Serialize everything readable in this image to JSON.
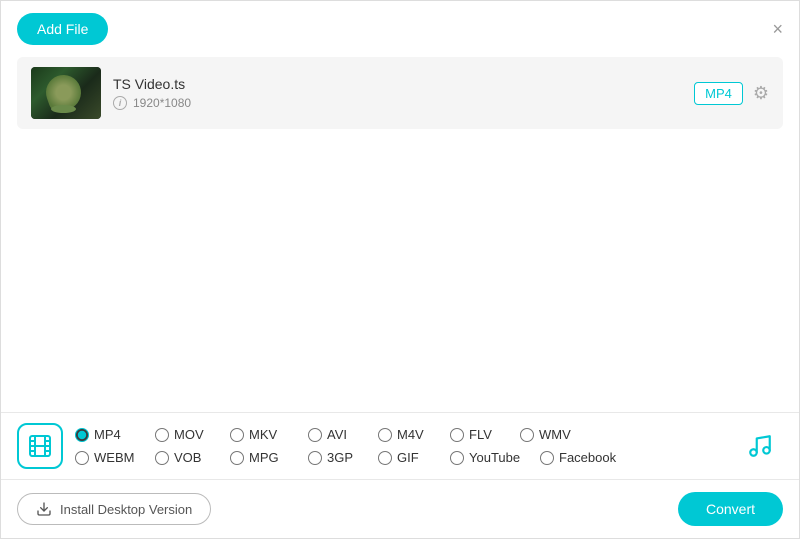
{
  "header": {
    "add_file_label": "Add File",
    "close_icon": "×"
  },
  "file": {
    "name": "TS Video.ts",
    "resolution": "1920*1080",
    "format": "MP4"
  },
  "format_options": {
    "row1": [
      {
        "id": "mp4",
        "label": "MP4",
        "checked": true
      },
      {
        "id": "mov",
        "label": "MOV",
        "checked": false
      },
      {
        "id": "mkv",
        "label": "MKV",
        "checked": false
      },
      {
        "id": "avi",
        "label": "AVI",
        "checked": false
      },
      {
        "id": "m4v",
        "label": "M4V",
        "checked": false
      },
      {
        "id": "flv",
        "label": "FLV",
        "checked": false
      },
      {
        "id": "wmv",
        "label": "WMV",
        "checked": false
      }
    ],
    "row2": [
      {
        "id": "webm",
        "label": "WEBM",
        "checked": false
      },
      {
        "id": "vob",
        "label": "VOB",
        "checked": false
      },
      {
        "id": "mpg",
        "label": "MPG",
        "checked": false
      },
      {
        "id": "3gp",
        "label": "3GP",
        "checked": false
      },
      {
        "id": "gif",
        "label": "GIF",
        "checked": false
      },
      {
        "id": "youtube",
        "label": "YouTube",
        "checked": false
      },
      {
        "id": "facebook",
        "label": "Facebook",
        "checked": false
      }
    ]
  },
  "actions": {
    "install_label": "Install Desktop Version",
    "convert_label": "Convert"
  },
  "icons": {
    "info": "i",
    "close": "✕",
    "download": "⬇",
    "film": "🎬",
    "music": "🎵"
  }
}
